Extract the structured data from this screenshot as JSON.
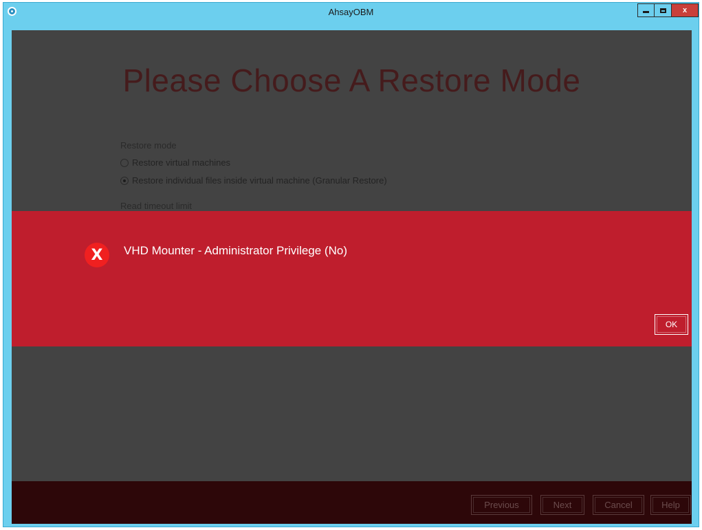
{
  "window": {
    "title": "AhsayOBM",
    "min_icon": "minimize-icon",
    "max_icon": "maximize-icon",
    "close_label": "x"
  },
  "page": {
    "heading": "Please Choose A Restore Mode",
    "restore_mode_label": "Restore mode",
    "options": [
      {
        "label": "Restore virtual machines",
        "selected": false
      },
      {
        "label": "Restore individual files inside virtual machine (Granular Restore)",
        "selected": true
      }
    ],
    "read_timeout_label": "Read timeout limit"
  },
  "alert": {
    "icon": "error-x-icon",
    "icon_glyph": "X",
    "message": "VHD Mounter - Administrator Privilege (No)",
    "ok_label": "OK",
    "background": "#bf1e2d"
  },
  "footer": {
    "previous_label": "Previous",
    "next_label": "Next",
    "cancel_label": "Cancel",
    "help_label": "Help"
  },
  "colors": {
    "titlebar": "#6ccfee",
    "content_overlay": "#434343",
    "footer": "#2d0709"
  }
}
